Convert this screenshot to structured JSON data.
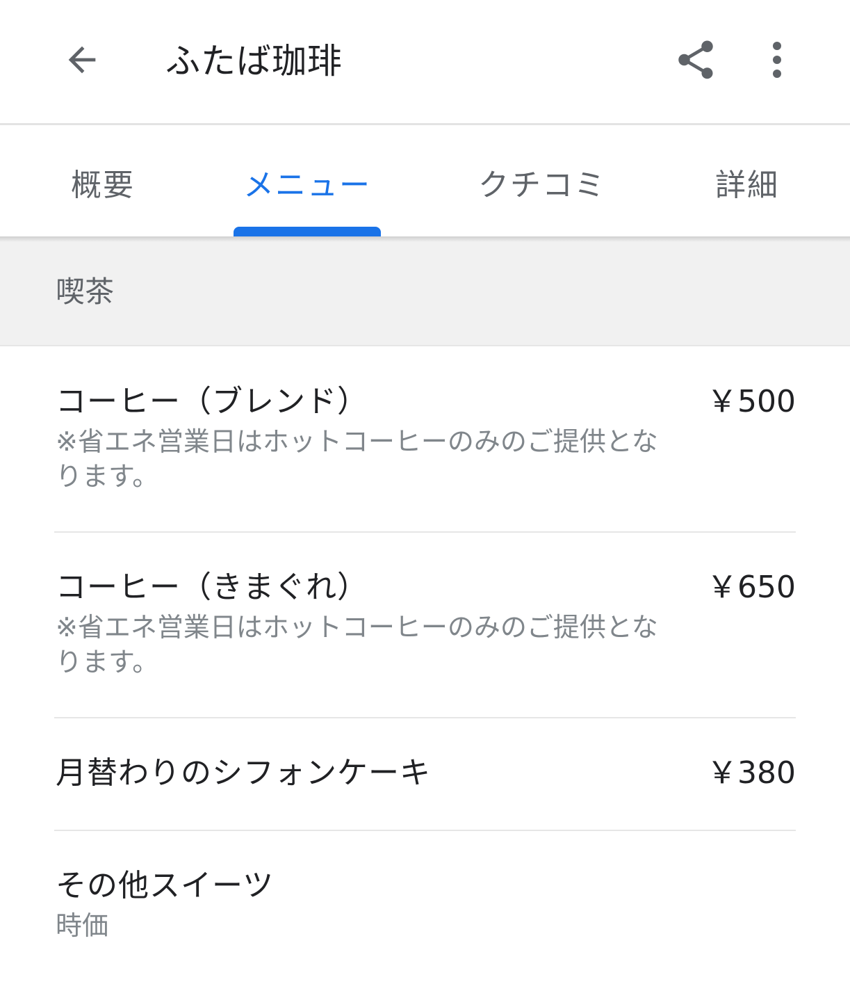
{
  "header": {
    "title": "ふたば珈琲",
    "back_icon": "arrow-back-icon",
    "share_icon": "share-icon",
    "more_icon": "more-vert-icon"
  },
  "tabs": [
    {
      "label": "概要",
      "active": false
    },
    {
      "label": "メニュー",
      "active": true
    },
    {
      "label": "クチコミ",
      "active": false
    },
    {
      "label": "詳細",
      "active": false
    }
  ],
  "section": {
    "title": "喫茶"
  },
  "menu_items": [
    {
      "name": "コーヒー（ブレンド）",
      "price": "￥500",
      "description": "※省エネ営業日はホットコーヒーのみのご提供となります。"
    },
    {
      "name": "コーヒー（きまぐれ）",
      "price": "￥650",
      "description": "※省エネ営業日はホットコーヒーのみのご提供となります。"
    },
    {
      "name": "月替わりのシフォンケーキ",
      "price": "￥380",
      "description": ""
    },
    {
      "name": "その他スイーツ",
      "price": "",
      "description": "時価"
    }
  ],
  "colors": {
    "accent": "#1a73e8",
    "text_primary": "#202124",
    "text_secondary": "#5f6368",
    "text_muted": "#80868b",
    "section_bg": "#f1f1f1"
  }
}
